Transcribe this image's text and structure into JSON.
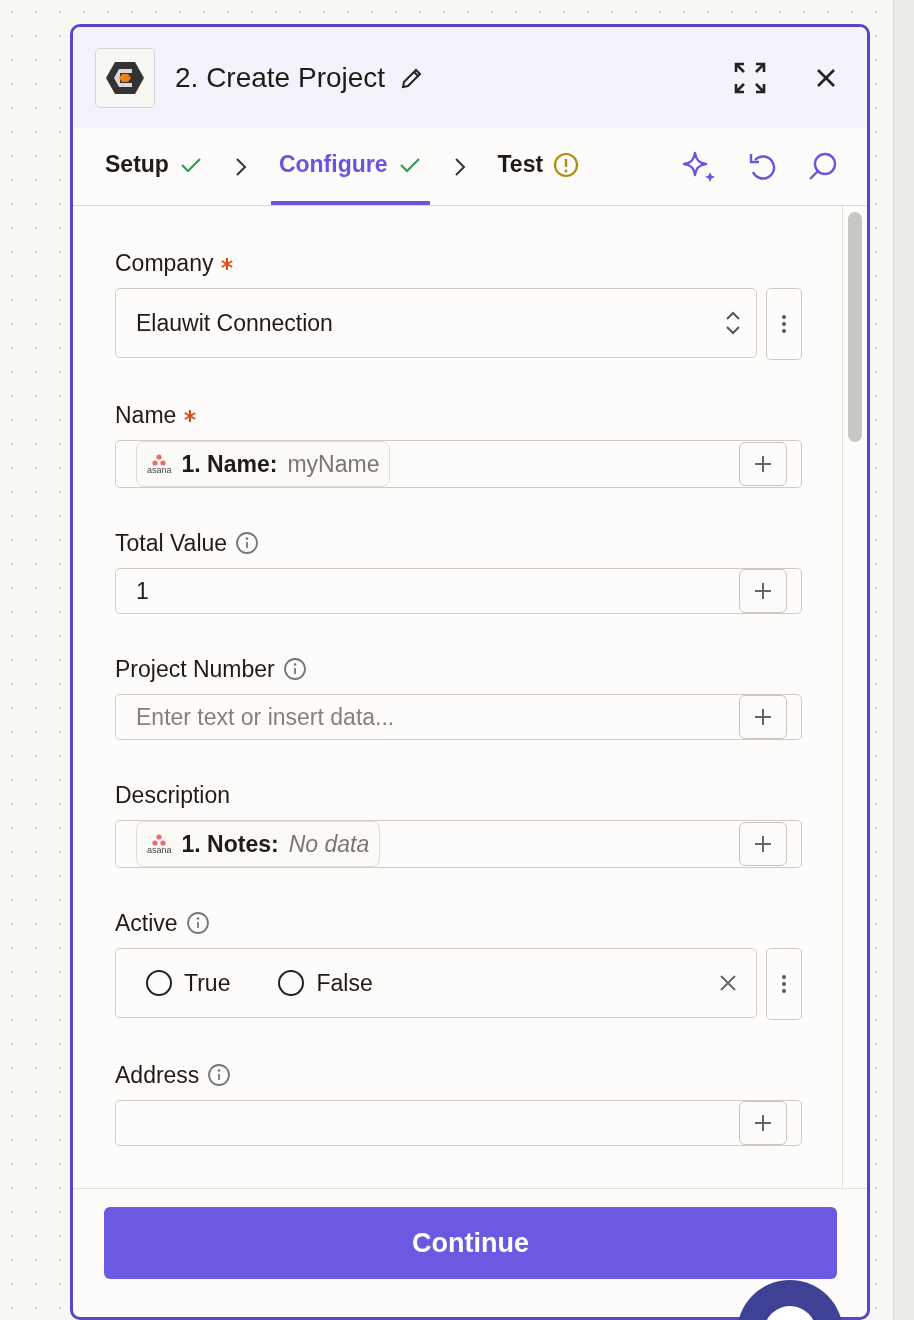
{
  "header": {
    "step_number": "2.",
    "title": "Create Project"
  },
  "tabs": [
    {
      "label": "Setup",
      "selected": false,
      "complete": true
    },
    {
      "label": "Configure",
      "selected": true,
      "complete": true
    },
    {
      "label": "Test",
      "selected": false,
      "complete": false
    }
  ],
  "fields": [
    {
      "kind": "select",
      "label": "Company",
      "required": true,
      "info": false,
      "value": "Elauwit Connection"
    },
    {
      "kind": "pill",
      "label": "Name",
      "required": true,
      "info": false,
      "pill": {
        "app": "asana",
        "name": "1. Name:",
        "value": "myName",
        "empty": false
      }
    },
    {
      "kind": "text",
      "label": "Total Value",
      "required": false,
      "info": true,
      "value": "1"
    },
    {
      "kind": "text",
      "label": "Project Number",
      "required": false,
      "info": true,
      "placeholder": "Enter text or insert data..."
    },
    {
      "kind": "pill",
      "label": "Description",
      "required": false,
      "info": false,
      "pill": {
        "app": "asana",
        "name": "1. Notes:",
        "value": "No data",
        "empty": true
      }
    },
    {
      "kind": "radio",
      "label": "Active",
      "required": false,
      "info": true,
      "options": [
        {
          "label": "True",
          "selected": false
        },
        {
          "label": "False",
          "selected": false
        }
      ]
    },
    {
      "kind": "text",
      "label": "Address",
      "required": false,
      "info": true
    }
  ],
  "footer": {
    "button": "Continue"
  }
}
